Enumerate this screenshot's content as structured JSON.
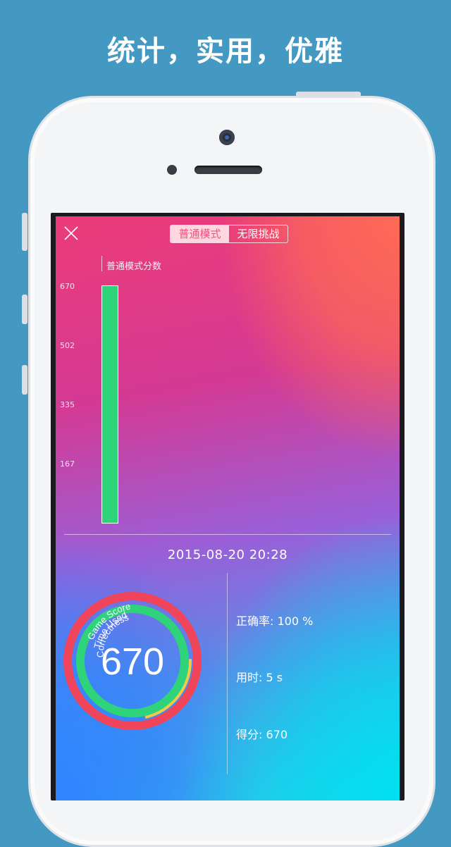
{
  "headline": "统计，实用，优雅",
  "segment": {
    "normal_label": "普通模式",
    "endless_label": "无限挑战",
    "active": "normal"
  },
  "chart_data": {
    "type": "bar",
    "title": "普通模式分数",
    "categories": [
      ""
    ],
    "values": [
      670
    ],
    "yticks": [
      "670",
      "502",
      "335",
      "167"
    ],
    "ylim": [
      0,
      670
    ],
    "bar_color": "#2ed37a"
  },
  "session": {
    "datetime": "2015-08-20   20:28",
    "score": "670",
    "ring_labels": {
      "game_score": "Game Score",
      "time_used": "Time Used",
      "correctness": "Correctness"
    },
    "rings": {
      "game_score": 1.0,
      "time_used": 0.22,
      "correctness": 1.0
    },
    "ring_colors": {
      "game_score": "#f0445a",
      "time_used": "#f1c94b",
      "correctness": "#2ed37a"
    },
    "stats": {
      "accuracy": "正确率: 100 %",
      "time": "用时: 5 s",
      "score": "得分: 670"
    }
  },
  "icons": {
    "close": "close-icon",
    "camera": "camera-icon"
  }
}
